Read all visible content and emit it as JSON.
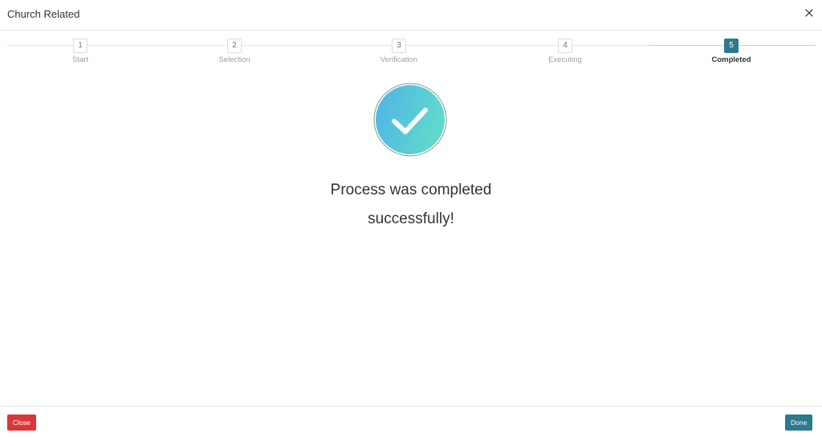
{
  "dialog": {
    "title": "Church Related",
    "close_icon": "close-icon"
  },
  "stepper": {
    "steps": [
      {
        "number": "1",
        "label": "Start"
      },
      {
        "number": "2",
        "label": "Selection"
      },
      {
        "number": "3",
        "label": "Verification"
      },
      {
        "number": "4",
        "label": "Executing"
      },
      {
        "number": "5",
        "label": "Completed"
      }
    ],
    "active_step": 5
  },
  "result": {
    "icon": "check-circle-icon",
    "line1": "Process was completed",
    "line2": "successfully!"
  },
  "footer": {
    "close_label": "Close",
    "done_label": "Done"
  },
  "colors": {
    "accent": "#2b7a8d",
    "danger": "#d9383a",
    "check_gradient_start": "#4fb3e6",
    "check_gradient_end": "#5fd9cc"
  }
}
